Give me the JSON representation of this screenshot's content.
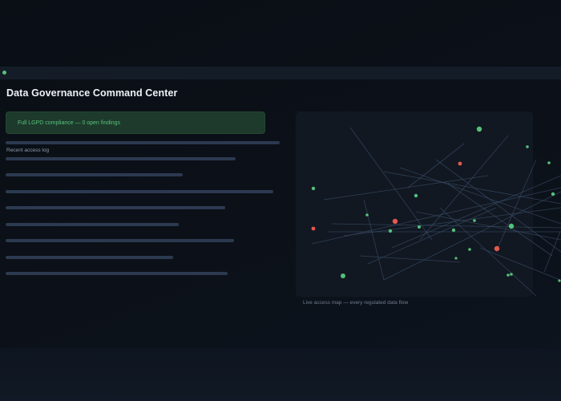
{
  "page": {
    "title": "Data Governance Command Center"
  },
  "compliance": {
    "status_text": "Full LGPD compliance — 0 open findings",
    "status_color": "#59c27d"
  },
  "access_log": {
    "label": "Recent access log",
    "entry_count_visible": 8
  },
  "access_map": {
    "caption": "Live access map — every regulated data flow",
    "node_colors": {
      "allowed": "#55c07a",
      "flagged": "#e5584f"
    },
    "nodes": [
      {
        "status": "allowed"
      },
      {
        "status": "allowed"
      },
      {
        "status": "allowed"
      },
      {
        "status": "allowed"
      },
      {
        "status": "allowed"
      },
      {
        "status": "allowed"
      },
      {
        "status": "allowed"
      },
      {
        "status": "allowed"
      },
      {
        "status": "allowed"
      },
      {
        "status": "allowed"
      },
      {
        "status": "allowed"
      },
      {
        "status": "allowed"
      },
      {
        "status": "allowed"
      },
      {
        "status": "allowed"
      },
      {
        "status": "allowed"
      },
      {
        "status": "allowed"
      },
      {
        "status": "allowed"
      },
      {
        "status": "allowed"
      },
      {
        "status": "flagged"
      },
      {
        "status": "flagged"
      },
      {
        "status": "flagged"
      },
      {
        "status": "flagged"
      }
    ]
  },
  "theme": {
    "accent": "#55c07a",
    "alert": "#e5584f",
    "background": "#0b0f17"
  }
}
